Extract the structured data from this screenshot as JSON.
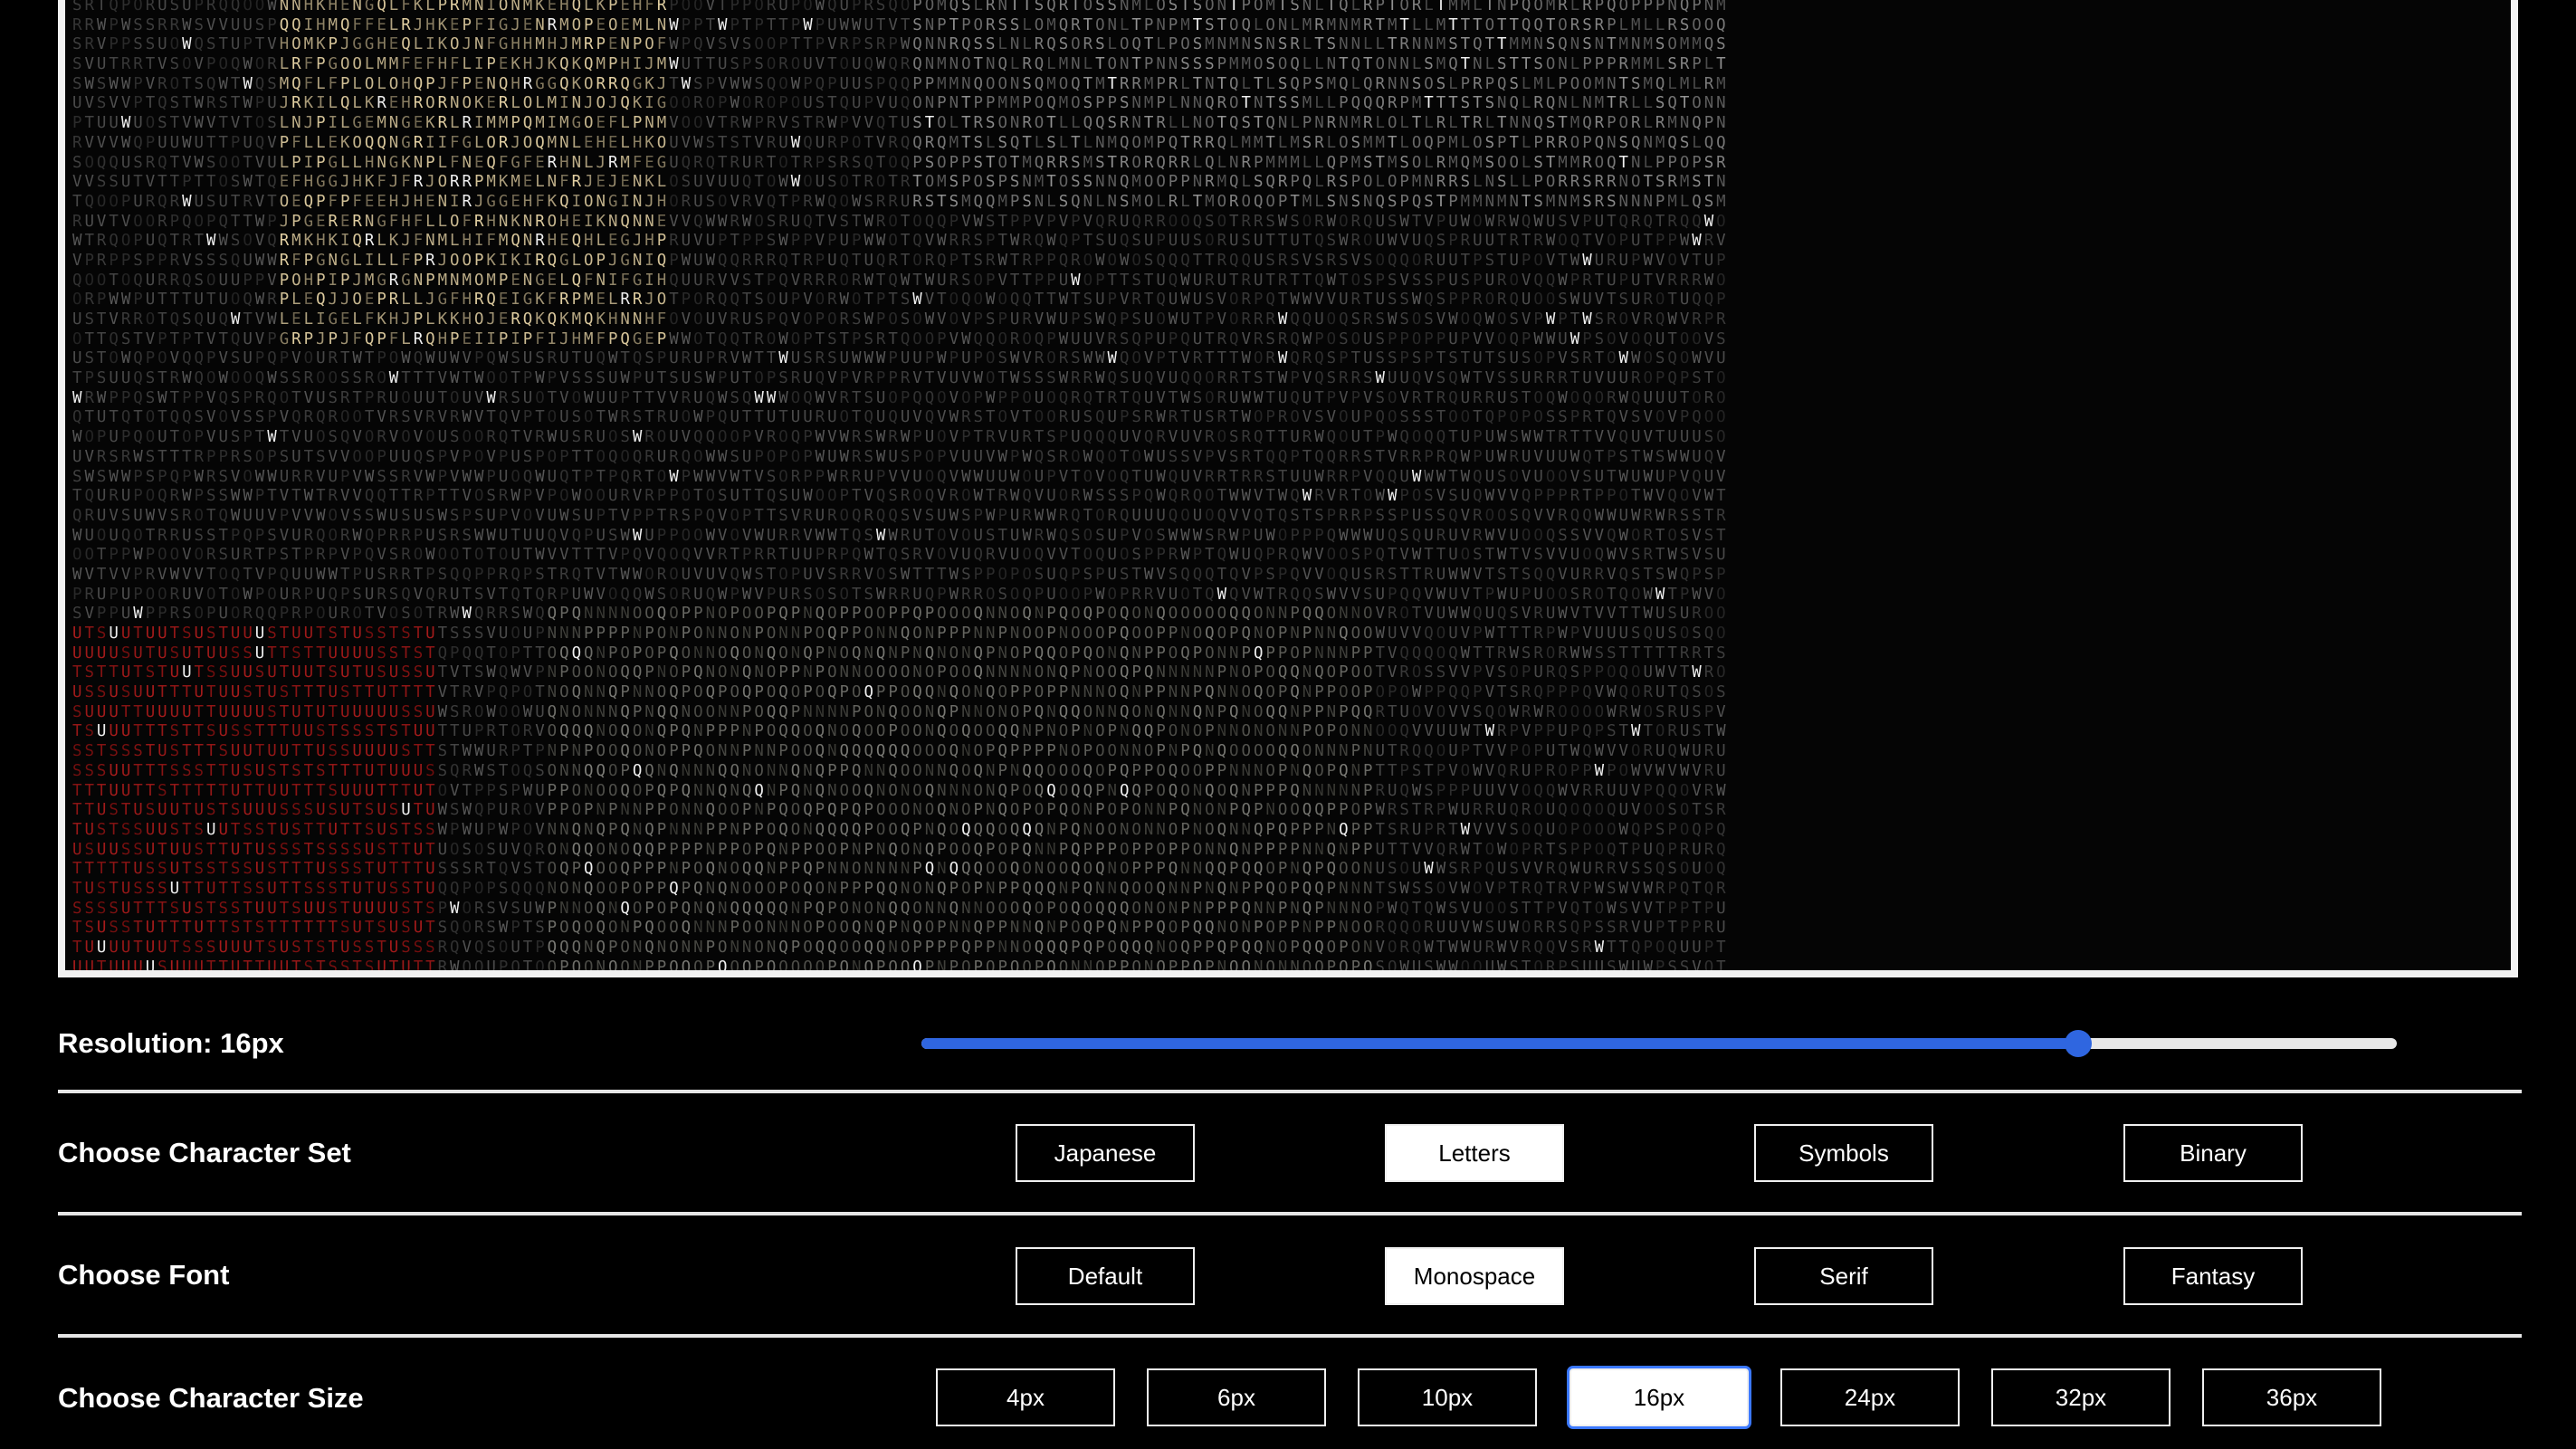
{
  "ascii": {
    "charset": "ABCDEFGHIJKLMNOPQRSTUVWXYZ"
  },
  "resolution": {
    "label": "Resolution: 16px",
    "value_fraction": 0.784
  },
  "character_set": {
    "label": "Choose Character Set",
    "options": [
      "Japanese",
      "Letters",
      "Symbols",
      "Binary"
    ],
    "selected": "Letters"
  },
  "font": {
    "label": "Choose Font",
    "options": [
      "Default",
      "Monospace",
      "Serif",
      "Fantasy"
    ],
    "selected": "Monospace"
  },
  "character_size": {
    "label": "Choose Character Size",
    "options": [
      "4px",
      "6px",
      "10px",
      "16px",
      "24px",
      "32px",
      "36px"
    ],
    "selected": "16px"
  },
  "colors": {
    "accent": "#2f66e0",
    "focus_ring": "#3b78ff",
    "background": "#000000"
  }
}
